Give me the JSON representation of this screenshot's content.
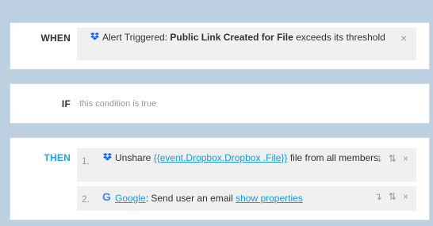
{
  "when": {
    "label": "WHEN",
    "trigger_prefix": "Alert Triggered: ",
    "trigger_bold": "Public Link Created for File",
    "trigger_suffix": " exceeds its threshold",
    "close": "×"
  },
  "if": {
    "label": "IF",
    "condition": "this condition is true"
  },
  "then": {
    "label": "THEN",
    "actions": [
      {
        "number": "1.",
        "prefix": "Unshare ",
        "link": "{{event.Dropbox.Dropbox .File}}",
        "suffix": " file from all members",
        "icon": "dropbox-icon"
      },
      {
        "number": "2.",
        "link": "Google",
        "middle": ": Send user an email ",
        "link2": "show properties",
        "icon": "google-icon"
      }
    ],
    "tool_indent": "↴",
    "tool_reorder": "⇅",
    "close": "×"
  },
  "colors": {
    "background": "#bcd0e2",
    "then_label": "#1ea7dc",
    "link": "#1a9bd8",
    "dropbox": "#0061fe",
    "google": "#4285f4"
  }
}
